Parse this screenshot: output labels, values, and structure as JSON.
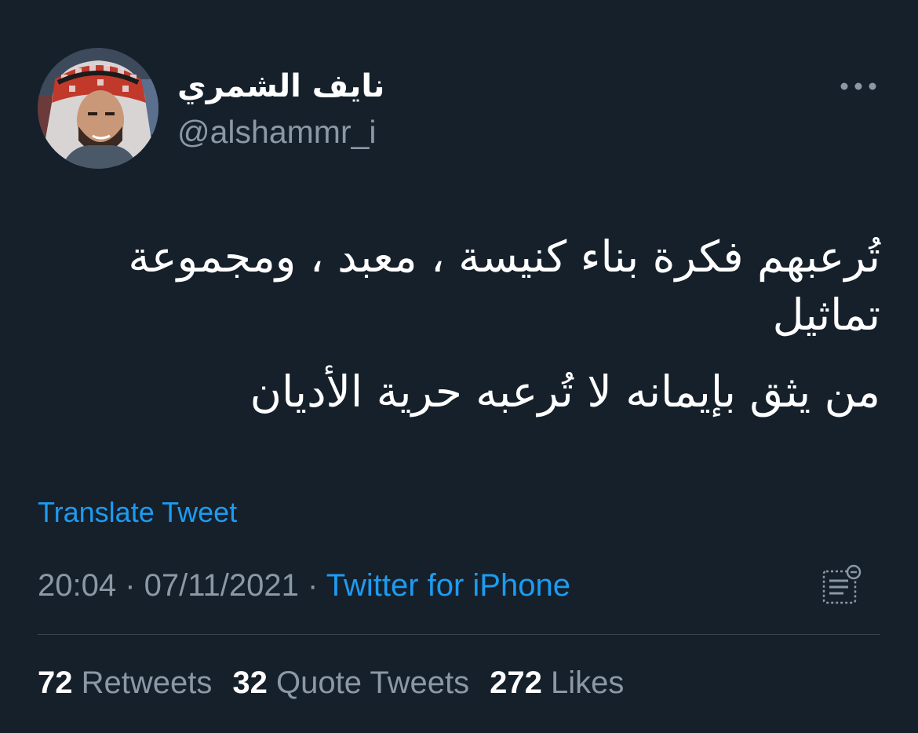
{
  "author": {
    "display_name": "نايف الشمري",
    "handle": "@alshammr_i"
  },
  "header": {
    "more_icon": "more-horizontal-icon"
  },
  "tweet": {
    "line1": "تُرعبهم فكرة بناء كنيسة ، معبد ، ومجموعة تماثيل",
    "line2": "من يثق بإيمانه لا تُرعبه حرية الأديان"
  },
  "translate_label": "Translate Tweet",
  "meta": {
    "time": "20:04",
    "separator": " · ",
    "date": "07/11/2021",
    "source": "Twitter for iPhone",
    "analytics_icon": "analytics-icon"
  },
  "stats": {
    "retweets_count": "72",
    "retweets_label": "Retweets",
    "quotes_count": "32",
    "quotes_label": "Quote Tweets",
    "likes_count": "272",
    "likes_label": "Likes"
  },
  "colors": {
    "background": "#15202b",
    "primary_text": "#ffffff",
    "secondary_text": "#8b98a5",
    "accent": "#1d9bf0",
    "divider": "#38444d"
  }
}
